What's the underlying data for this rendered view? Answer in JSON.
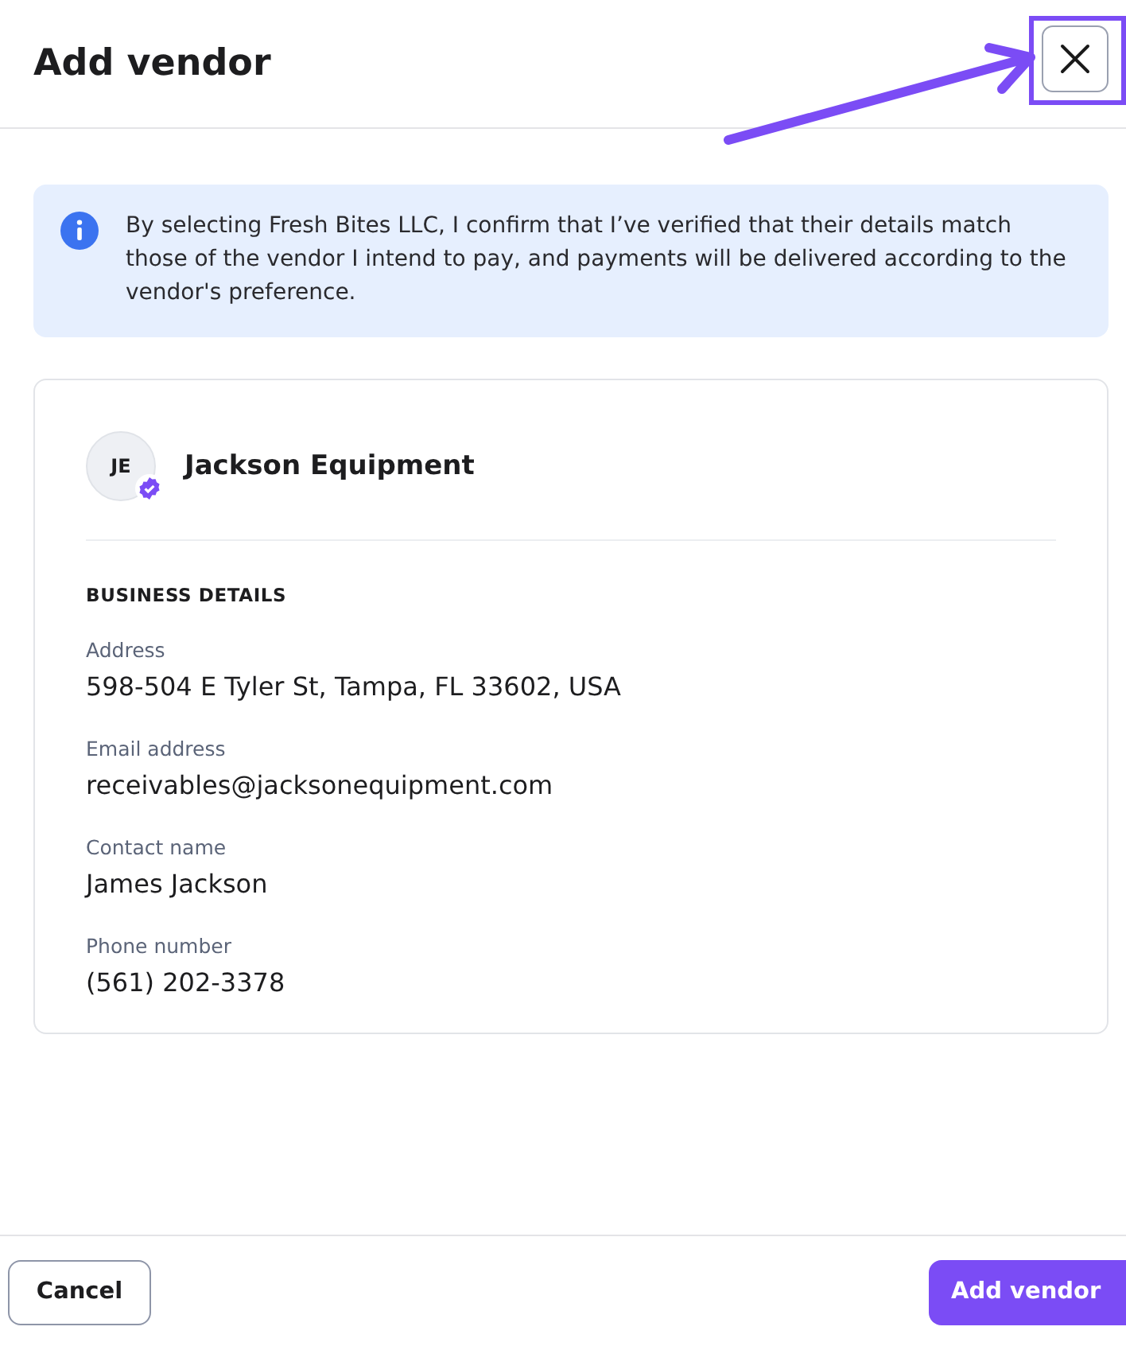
{
  "header": {
    "title": "Add vendor"
  },
  "notice": {
    "text": "By selecting Fresh Bites LLC, I confirm that I’ve verified that their details match those of the vendor I intend to pay, and payments will be delivered according to the vendor's preference."
  },
  "vendor": {
    "initials": "JE",
    "name": "Jackson Equipment",
    "verified": true
  },
  "section_title": "BUSINESS DETAILS",
  "details": [
    {
      "label": "Address",
      "value": "598-504 E Tyler St, Tampa, FL 33602, USA"
    },
    {
      "label": "Email address",
      "value": "receivables@jacksonequipment.com"
    },
    {
      "label": "Contact name",
      "value": "James Jackson"
    },
    {
      "label": "Phone number",
      "value": "(561) 202-3378"
    }
  ],
  "footer": {
    "cancel": "Cancel",
    "submit": "Add vendor"
  }
}
